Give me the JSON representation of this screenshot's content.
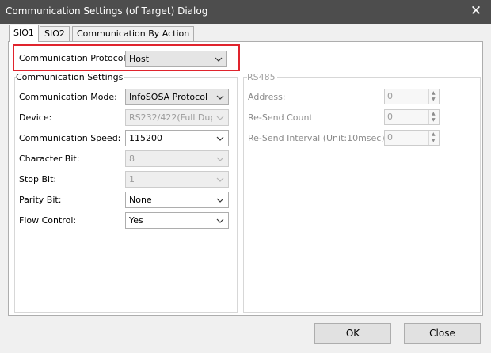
{
  "window": {
    "title": "Communication Settings (of Target) Dialog",
    "close_glyph": "✕"
  },
  "tabs": [
    {
      "label": "SIO1",
      "active": true
    },
    {
      "label": "SIO2",
      "active": false
    },
    {
      "label": "Communication By Action",
      "active": false
    }
  ],
  "protocol": {
    "label": "Communication Protocol:",
    "value": "Host"
  },
  "comm_settings": {
    "title": "Communication Settings",
    "fields": [
      {
        "label": "Communication Mode:",
        "value": "InfoSOSA Protocol",
        "enabled": true
      },
      {
        "label": "Device:",
        "value": "RS232/422(Full Dupl",
        "enabled": false
      },
      {
        "label": "Communication Speed:",
        "value": "115200",
        "enabled": true
      },
      {
        "label": "Character Bit:",
        "value": "8",
        "enabled": false
      },
      {
        "label": "Stop Bit:",
        "value": "1",
        "enabled": false
      },
      {
        "label": "Parity Bit:",
        "value": "None",
        "enabled": true
      },
      {
        "label": "Flow Control:",
        "value": "Yes",
        "enabled": true
      }
    ]
  },
  "rs485": {
    "title": "RS485",
    "fields": [
      {
        "label": "Address:",
        "value": "0"
      },
      {
        "label": "Re-Send Count",
        "value": "0"
      },
      {
        "label": "Re-Send Interval (Unit:10msec)",
        "value": "0"
      }
    ]
  },
  "buttons": {
    "ok": "OK",
    "close": "Close"
  },
  "colors": {
    "titlebar": "#4d4d4d",
    "highlight": "#e0242d",
    "dialog_bg": "#f0f0f0"
  }
}
